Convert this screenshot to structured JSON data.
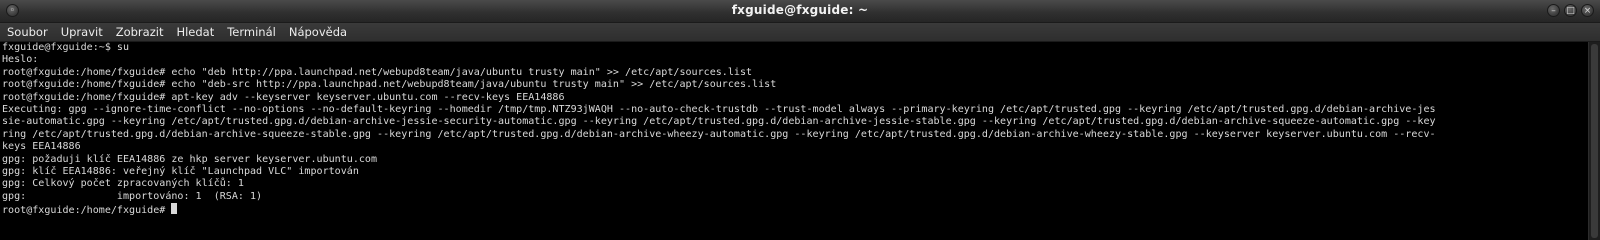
{
  "window": {
    "title": "fxguide@fxguide: ~"
  },
  "menu": {
    "items": [
      "Soubor",
      "Upravit",
      "Zobrazit",
      "Hledat",
      "Terminál",
      "Nápověda"
    ]
  },
  "terminal": {
    "lines": [
      "fxguide@fxguide:~$ su",
      "Heslo:",
      "root@fxguide:/home/fxguide# echo \"deb http://ppa.launchpad.net/webupd8team/java/ubuntu trusty main\" >> /etc/apt/sources.list",
      "root@fxguide:/home/fxguide# echo \"deb-src http://ppa.launchpad.net/webupd8team/java/ubuntu trusty main\" >> /etc/apt/sources.list",
      "root@fxguide:/home/fxguide# apt-key adv --keyserver keyserver.ubuntu.com --recv-keys EEA14886",
      "Executing: gpg --ignore-time-conflict --no-options --no-default-keyring --homedir /tmp/tmp.NTZ93jWAQH --no-auto-check-trustdb --trust-model always --primary-keyring /etc/apt/trusted.gpg --keyring /etc/apt/trusted.gpg.d/debian-archive-jes",
      "sie-automatic.gpg --keyring /etc/apt/trusted.gpg.d/debian-archive-jessie-security-automatic.gpg --keyring /etc/apt/trusted.gpg.d/debian-archive-jessie-stable.gpg --keyring /etc/apt/trusted.gpg.d/debian-archive-squeeze-automatic.gpg --key",
      "ring /etc/apt/trusted.gpg.d/debian-archive-squeeze-stable.gpg --keyring /etc/apt/trusted.gpg.d/debian-archive-wheezy-automatic.gpg --keyring /etc/apt/trusted.gpg.d/debian-archive-wheezy-stable.gpg --keyserver keyserver.ubuntu.com --recv-",
      "keys EEA14886",
      "gpg: požaduji klíč EEA14886 ze hkp server keyserver.ubuntu.com",
      "gpg: klíč EEA14886: veřejný klíč \"Launchpad VLC\" importován",
      "gpg: Celkový počet zpracovaných klíčů: 1",
      "gpg:               importováno: 1  (RSA: 1)",
      "root@fxguide:/home/fxguide# "
    ]
  }
}
